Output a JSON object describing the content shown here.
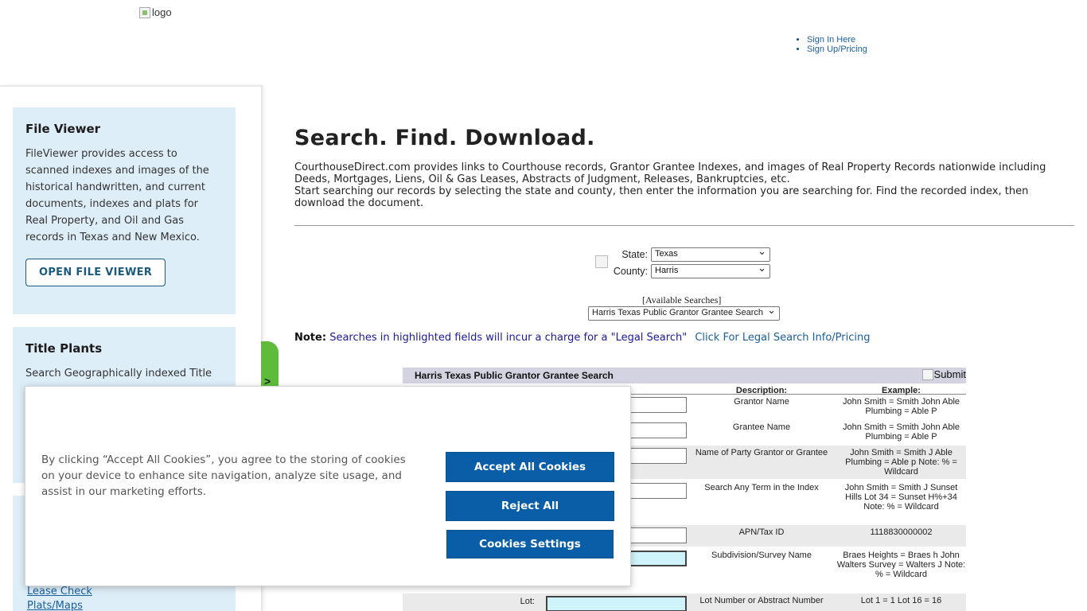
{
  "header": {
    "logo_alt": "logo",
    "links": [
      "Sign In Here",
      "Sign Up/Pricing"
    ]
  },
  "sidebar": {
    "file_viewer": {
      "title": "File Viewer",
      "text": "FileViewer provides access to scanned indexes and images of the historical handwritten, and current documents, indexes and plats for Real Property, and Oil and Gas records in Texas and New Mexico.",
      "button": "OPEN FILE VIEWER"
    },
    "title_plants": {
      "title": "Title Plants",
      "text": "Search Geographically indexed Title"
    },
    "links": [
      "Lease Check",
      "Plats/Maps"
    ],
    "tab_glyph": ">"
  },
  "main": {
    "title": "Search. Find. Download.",
    "intro_1": "CourthouseDirect.com provides links to Courthouse records, Grantor Grantee Indexes, and images of Real Property Records nationwide including Deeds, Mortgages, Liens, Oil & Gas Leases, Abstracts of Judgment, Releases, Bankruptcies, etc.",
    "intro_2": "Start searching our records by selecting the state and county, then enter the information you are searching for. Find the recorded index, then download the document.",
    "state_label": "State:",
    "state_value": "Texas",
    "county_label": "County:",
    "county_value": "Harris",
    "available_label": "[Available Searches]",
    "available_value": "Harris Texas Public Grantor Grantee Search",
    "note_label": "Note:",
    "note_text": "Searches in highlighted fields will incur a charge for a \"Legal Search\"",
    "note_link": "Click For Legal Search Info/Pricing"
  },
  "search": {
    "title": "Harris Texas Public Grantor Grantee Search",
    "submit_alt": "Submit",
    "col_field_suffix": ":",
    "col_desc": "Description:",
    "col_example": "Example:",
    "rows": [
      {
        "label": "",
        "desc": "Grantor Name",
        "example": "John Smith = Smith John Able Plumbing = Able P",
        "highlight": false
      },
      {
        "label": "",
        "desc": "Grantee Name",
        "example": "John Smith = Smith John Able Plumbing = Able P",
        "highlight": false
      },
      {
        "label": "",
        "desc": "Name of Party Grantor or Grantee",
        "example": "John Smith = Smith J Able Plumbing = Able p Note: % = Wildcard",
        "highlight": false
      },
      {
        "label": "",
        "desc": "Search Any Term in the Index",
        "example": "John Smith = Smith J Sunset Hills Lot 34 = Sunset H%+34 Note: % = Wildcard",
        "highlight": false
      },
      {
        "label": "",
        "desc": "APN/Tax ID",
        "example": "1118830000002",
        "highlight": false
      },
      {
        "label": "",
        "desc": "Subdivision/Survey Name",
        "example": "Braes Heights = Braes h John Walters Survey = Walters J Note: % = Wildcard",
        "highlight": true
      },
      {
        "label": "Lot:",
        "desc": "Lot Number or Abstract Number",
        "example": "Lot 1 = 1 Lot 16 = 16",
        "highlight": true
      }
    ]
  },
  "cookie": {
    "text": "By clicking “Accept All Cookies”, you agree to the storing of cookies on your device to enhance site navigation, analyze site usage, and assist in our marketing efforts.",
    "accept": "Accept All Cookies",
    "reject": "Reject All",
    "settings": "Cookies Settings"
  },
  "colors": {
    "cookie_button": "#0a5ea8",
    "sidebar_card": "#deeef8",
    "green_tab": "#5dbd3b",
    "highlight_field": "#cff3fb"
  }
}
